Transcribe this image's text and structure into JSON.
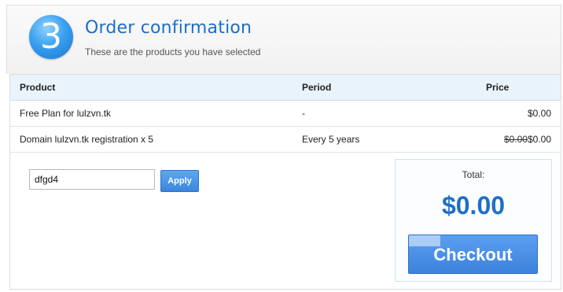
{
  "header": {
    "step_number": "3",
    "title": "Order confirmation",
    "subtitle": "These are the products you have selected"
  },
  "table": {
    "columns": [
      "Product",
      "Period",
      "Price"
    ],
    "rows": [
      {
        "product": "Free Plan for lulzvn.tk",
        "period": "-",
        "old_price": "",
        "price": "$0.00"
      },
      {
        "product": "Domain lulzvn.tk registration x 5",
        "period": "Every 5 years",
        "old_price": "$0.00",
        "price": "$0.00"
      }
    ]
  },
  "coupon": {
    "value": "dfgd4",
    "apply_label": "Apply"
  },
  "total": {
    "label": "Total:",
    "amount": "$0.00",
    "checkout_label": "Checkout"
  },
  "colors": {
    "accent": "#1b6fc6",
    "button": "#3d83dc",
    "table_header_bg": "#e9f3fb"
  }
}
